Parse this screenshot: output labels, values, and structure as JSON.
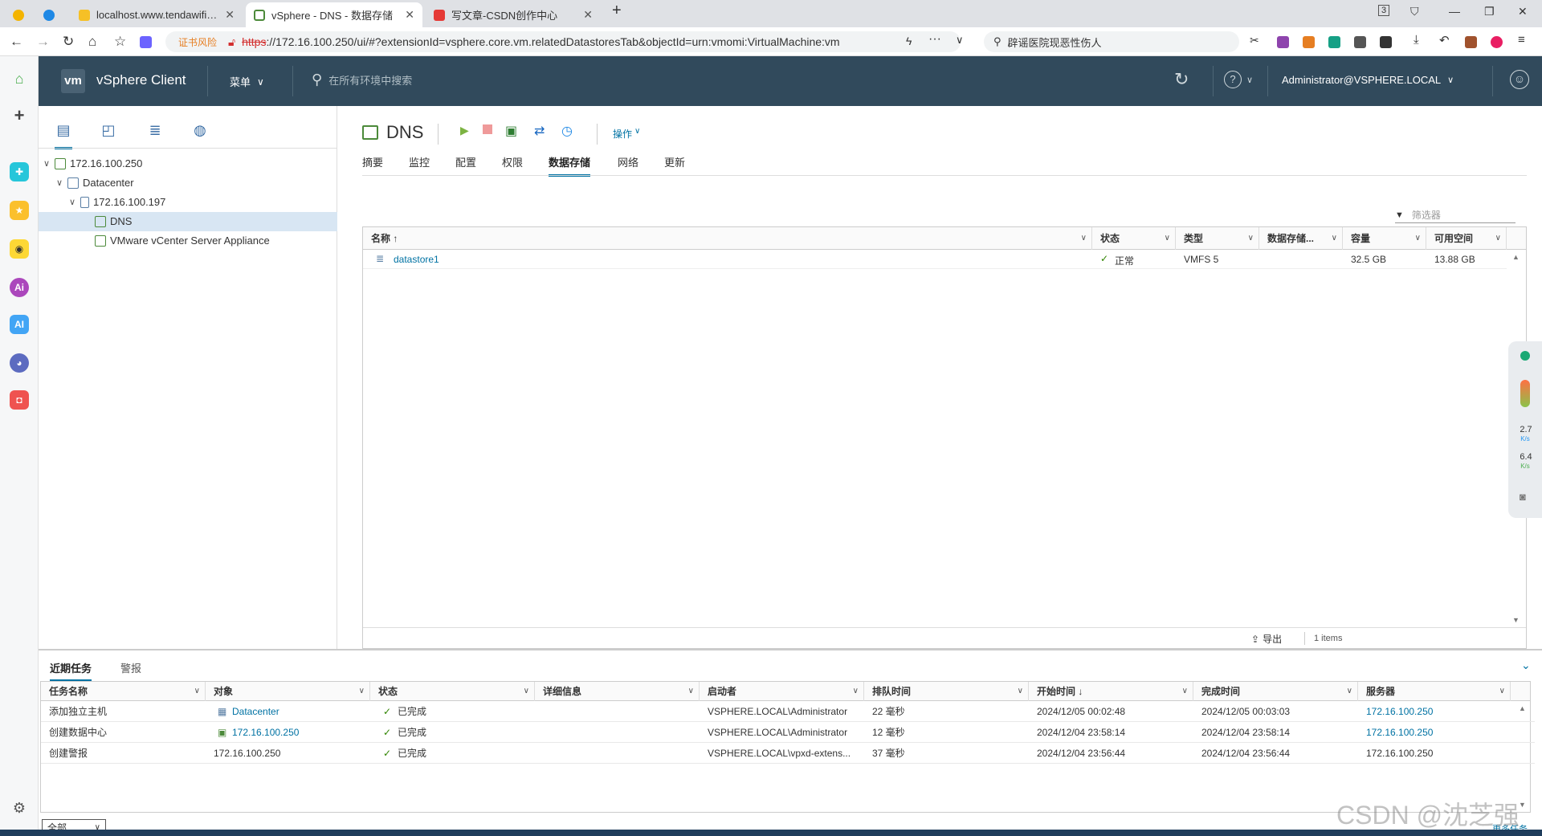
{
  "browser": {
    "tabs": [
      {
        "title": "",
        "color": "#f4b400"
      },
      {
        "title": "",
        "color": "#1e88e5"
      },
      {
        "title": "localhost.www.tendawifi.com",
        "color": "#f6c026"
      },
      {
        "title": "vSphere - DNS - 数据存储",
        "color": "#4c8a3a"
      },
      {
        "title": "写文章-CSDN创作中心",
        "color": "#e53935"
      }
    ],
    "tab_counter": "3",
    "security_warning": "证书风险",
    "url_scheme": "https",
    "url_rest": "://172.16.100.250/ui/#?extensionId=vsphere.core.vm.relatedDatastoresTab&objectId=urn:vmomi:VirtualMachine:vm",
    "search_text": "辟谣医院现恶性伤人"
  },
  "vsphere": {
    "logo": "vm",
    "app_name": "vSphere Client",
    "menu_label": "菜单",
    "search_placeholder": "在所有环境中搜索",
    "user": "Administrator@VSPHERE.LOCAL"
  },
  "tree": [
    {
      "label": "172.16.100.250",
      "caret": "∨",
      "indent": 0
    },
    {
      "label": "Datacenter",
      "caret": "∨",
      "indent": 1
    },
    {
      "label": "172.16.100.197",
      "caret": "∨",
      "indent": 2
    },
    {
      "label": "DNS",
      "caret": "",
      "indent": 3,
      "selected": true
    },
    {
      "label": "VMware vCenter Server Appliance",
      "caret": "",
      "indent": 3
    }
  ],
  "object": {
    "name": "DNS",
    "actions_label": "操作",
    "tabs": [
      "摘要",
      "监控",
      "配置",
      "权限",
      "数据存储",
      "网络",
      "更新"
    ],
    "selected_tab": "数据存储"
  },
  "datastores": {
    "filter_placeholder": "筛选器",
    "columns": [
      "名称 ↑",
      "状态",
      "类型",
      "数据存储...",
      "容量",
      "可用空间"
    ],
    "rows": [
      {
        "name": "datastore1",
        "status": "正常",
        "type": "VMFS 5",
        "cluster": "",
        "capacity": "32.5 GB",
        "free": "13.88 GB"
      }
    ],
    "export_label": "导出",
    "items_count": "1 items"
  },
  "tasks": {
    "tabs": [
      "近期任务",
      "警报"
    ],
    "columns": [
      "任务名称",
      "对象",
      "状态",
      "详细信息",
      "启动者",
      "排队时间",
      "开始时间 ↓",
      "完成时间",
      "服务器"
    ],
    "rows": [
      {
        "name": "添加独立主机",
        "object": "Datacenter",
        "object_link": true,
        "status": "已完成",
        "details": "",
        "initiator": "VSPHERE.LOCAL\\Administrator",
        "queued": "22 毫秒",
        "start": "2024/12/05 00:02:48",
        "end": "2024/12/05 00:03:03",
        "server": "172.16.100.250",
        "server_link": true
      },
      {
        "name": "创建数据中心",
        "object": "172.16.100.250",
        "object_link": true,
        "status": "已完成",
        "details": "",
        "initiator": "VSPHERE.LOCAL\\Administrator",
        "queued": "12 毫秒",
        "start": "2024/12/04 23:58:14",
        "end": "2024/12/04 23:58:14",
        "server": "172.16.100.250",
        "server_link": true
      },
      {
        "name": "创建警报",
        "object": "172.16.100.250",
        "object_link": false,
        "status": "已完成",
        "details": "",
        "initiator": "VSPHERE.LOCAL\\vpxd-extens...",
        "queued": "37 毫秒",
        "start": "2024/12/04 23:56:44",
        "end": "2024/12/04 23:56:44",
        "server": "172.16.100.250",
        "server_link": false
      }
    ],
    "filter_value": "全部",
    "more_label": "更多任务"
  },
  "perf": {
    "up": "2.7",
    "down": "6.4",
    "unit": "K/s"
  },
  "watermark": "CSDN @沈芝强"
}
